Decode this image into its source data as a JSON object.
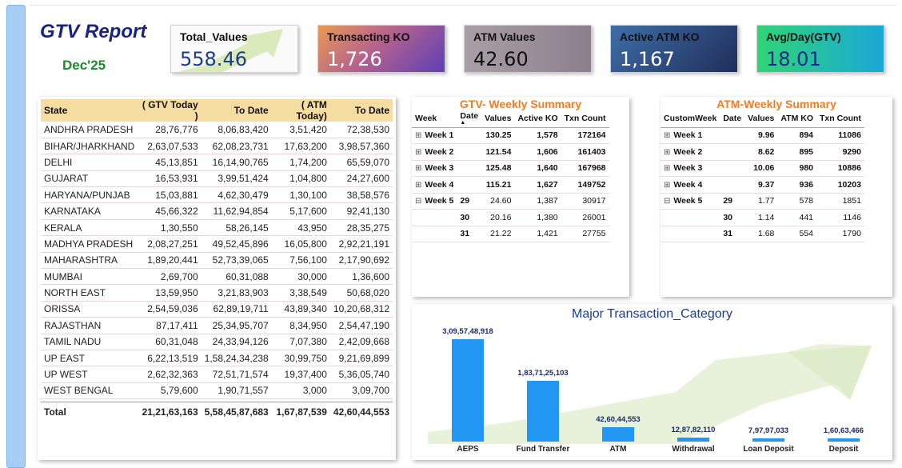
{
  "report": {
    "title": "GTV Report",
    "period": "Dec'25"
  },
  "kpis": [
    {
      "label": "Total_Values",
      "value": "558.46"
    },
    {
      "label": "Transacting KO",
      "value": "1,726"
    },
    {
      "label": "ATM Values",
      "value": "42.60"
    },
    {
      "label": "Active ATM KO",
      "value": "1,167"
    },
    {
      "label": "Avg/Day(GTV)",
      "value": "18.01"
    }
  ],
  "state_table": {
    "headers": [
      "State",
      "( GTV Today )",
      "To Date",
      "( ATM Today)",
      "To Date"
    ],
    "rows": [
      [
        "ANDHRA PRADESH",
        "28,76,776",
        "8,06,83,420",
        "3,51,420",
        "72,38,530"
      ],
      [
        "BIHAR/JHARKHAND",
        "2,63,07,533",
        "62,08,23,731",
        "17,63,200",
        "3,98,57,360"
      ],
      [
        "DELHI",
        "45,13,851",
        "16,14,90,765",
        "1,74,200",
        "65,59,070"
      ],
      [
        "GUJARAT",
        "16,53,931",
        "3,99,51,424",
        "1,04,800",
        "24,27,600"
      ],
      [
        "HARYANA/PUNJAB",
        "15,03,881",
        "4,62,30,479",
        "1,30,100",
        "38,58,576"
      ],
      [
        "KARNATAKA",
        "45,66,322",
        "11,62,94,854",
        "5,17,600",
        "92,41,130"
      ],
      [
        "KERALA",
        "1,30,550",
        "58,26,145",
        "43,950",
        "28,35,275"
      ],
      [
        "MADHYA PRADESH",
        "2,08,27,251",
        "49,52,45,896",
        "16,05,800",
        "2,92,21,191"
      ],
      [
        "MAHARASHTRA",
        "1,89,20,441",
        "52,73,39,065",
        "7,56,100",
        "2,17,90,692"
      ],
      [
        "MUMBAI",
        "2,69,700",
        "60,31,088",
        "30,000",
        "1,36,600"
      ],
      [
        "NORTH EAST",
        "13,59,950",
        "3,21,83,903",
        "3,38,549",
        "50,68,020"
      ],
      [
        "ORISSA",
        "2,54,59,036",
        "62,89,19,711",
        "43,89,340",
        "10,20,68,312"
      ],
      [
        "RAJASTHAN",
        "87,17,411",
        "25,34,95,707",
        "8,34,950",
        "2,54,47,190"
      ],
      [
        "TAMIL NADU",
        "60,31,048",
        "24,33,94,126",
        "7,07,380",
        "2,42,09,668"
      ],
      [
        "UP EAST",
        "6,22,13,519",
        "1,58,24,34,238",
        "30,99,750",
        "9,21,69,899"
      ],
      [
        "UP WEST",
        "2,62,32,363",
        "72,51,71,574",
        "19,37,400",
        "5,36,05,740"
      ],
      [
        "WEST BENGAL",
        "5,79,600",
        "1,90,71,557",
        "3,000",
        "3,09,700"
      ]
    ],
    "total": [
      "Total",
      "21,21,63,163",
      "5,58,45,87,683",
      "1,67,87,539",
      "42,60,44,553"
    ]
  },
  "gtv_weekly": {
    "title": "GTV- Weekly Summary",
    "headers": [
      "Week",
      "Date",
      "Values",
      "Active KO",
      "Txn Count"
    ],
    "rows": [
      {
        "week": "Week 1",
        "toggle": "⊞",
        "date": "",
        "values": "130.25",
        "ko": "1,578",
        "txn": "172164",
        "bold": true
      },
      {
        "week": "Week 2",
        "toggle": "⊞",
        "date": "",
        "values": "121.54",
        "ko": "1,606",
        "txn": "161403",
        "bold": true
      },
      {
        "week": "Week 3",
        "toggle": "⊞",
        "date": "",
        "values": "125.48",
        "ko": "1,640",
        "txn": "167968",
        "bold": true
      },
      {
        "week": "Week 4",
        "toggle": "⊞",
        "date": "",
        "values": "115.21",
        "ko": "1,627",
        "txn": "149752",
        "bold": true
      },
      {
        "week": "Week 5",
        "toggle": "⊟",
        "date": "29",
        "values": "24.60",
        "ko": "1,387",
        "txn": "30917",
        "bold": false
      },
      {
        "week": "",
        "toggle": "",
        "date": "30",
        "values": "20.16",
        "ko": "1,380",
        "txn": "26001",
        "bold": false
      },
      {
        "week": "",
        "toggle": "",
        "date": "31",
        "values": "21.22",
        "ko": "1,421",
        "txn": "27755",
        "bold": false
      }
    ]
  },
  "atm_weekly": {
    "title": "ATM-Weekly Summary",
    "headers": [
      "CustomWeek",
      "Date",
      "Values",
      "ATM KO",
      "Txn Count"
    ],
    "rows": [
      {
        "week": "Week 1",
        "toggle": "⊞",
        "date": "",
        "values": "9.96",
        "ko": "894",
        "txn": "11086",
        "bold": true
      },
      {
        "week": "Week 2",
        "toggle": "⊞",
        "date": "",
        "values": "8.62",
        "ko": "895",
        "txn": "9290",
        "bold": true
      },
      {
        "week": "Week 3",
        "toggle": "⊞",
        "date": "",
        "values": "10.06",
        "ko": "980",
        "txn": "10886",
        "bold": true
      },
      {
        "week": "Week 4",
        "toggle": "⊞",
        "date": "",
        "values": "9.37",
        "ko": "936",
        "txn": "10203",
        "bold": true
      },
      {
        "week": "Week 5",
        "toggle": "⊟",
        "date": "29",
        "values": "1.77",
        "ko": "578",
        "txn": "1851",
        "bold": false
      },
      {
        "week": "",
        "toggle": "",
        "date": "30",
        "values": "1.14",
        "ko": "441",
        "txn": "1146",
        "bold": false
      },
      {
        "week": "",
        "toggle": "",
        "date": "31",
        "values": "1.68",
        "ko": "554",
        "txn": "1790",
        "bold": false
      }
    ]
  },
  "chart_data": {
    "type": "bar",
    "title": "Major Transaction_Category",
    "categories": [
      "AEPS",
      "Fund Transfer",
      "ATM",
      "Withdrawal",
      "Loan Deposit",
      "Deposit"
    ],
    "values": [
      3095748918,
      1837125103,
      426044553,
      128782110,
      79797033,
      16063466
    ],
    "data_labels": [
      "3,09,57,48,918",
      "1,83,71,25,103",
      "42,60,44,553",
      "12,87,82,110",
      "7,97,97,033",
      "1,60,63,466"
    ],
    "bar_color": "#2196f3"
  }
}
